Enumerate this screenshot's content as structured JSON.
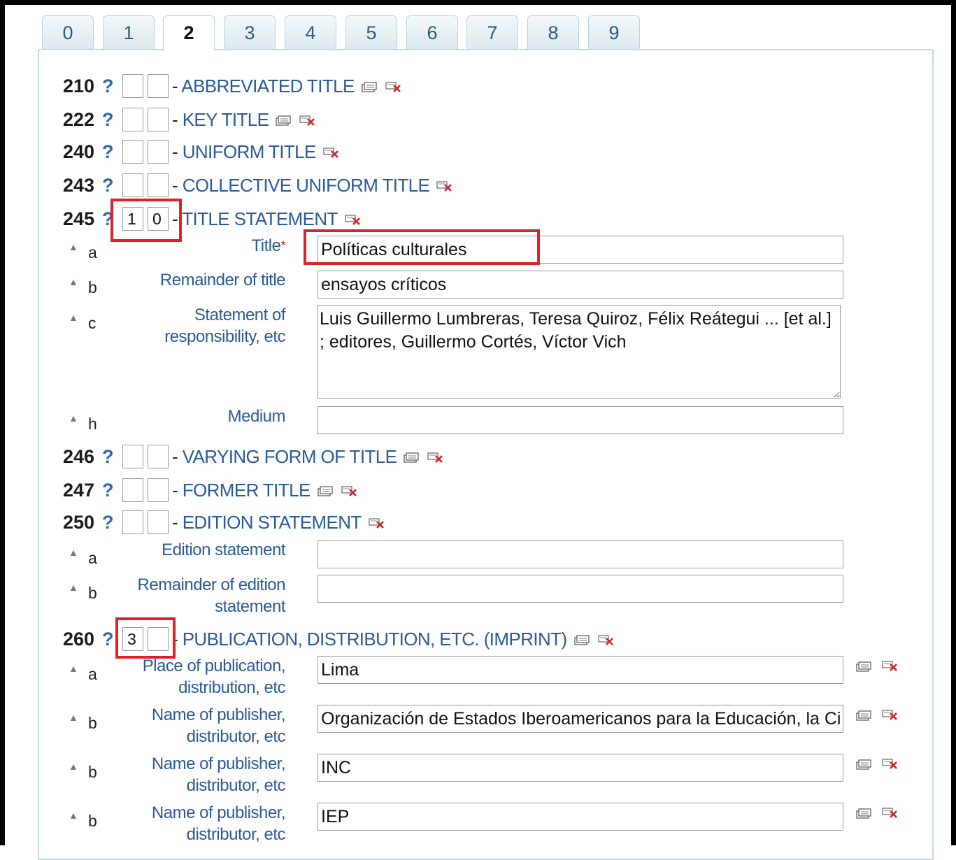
{
  "tabs": [
    "0",
    "1",
    "2",
    "3",
    "4",
    "5",
    "6",
    "7",
    "8",
    "9"
  ],
  "active_tab": "2",
  "help_symbol": "?",
  "fields": {
    "f210": {
      "tag": "210",
      "ind1": "",
      "ind2": "",
      "label": "ABBREVIATED TITLE"
    },
    "f222": {
      "tag": "222",
      "ind1": "",
      "ind2": "",
      "label": "KEY TITLE"
    },
    "f240": {
      "tag": "240",
      "ind1": "",
      "ind2": "",
      "label": "UNIFORM TITLE"
    },
    "f243": {
      "tag": "243",
      "ind1": "",
      "ind2": "",
      "label": "COLLECTIVE UNIFORM TITLE"
    },
    "f245": {
      "tag": "245",
      "ind1": "1",
      "ind2": "0",
      "label": "TITLE STATEMENT",
      "subfields": {
        "a": {
          "code": "a",
          "label": "Title",
          "required_mark": "*",
          "value": "Políticas culturales"
        },
        "b": {
          "code": "b",
          "label": "Remainder of title",
          "value": "ensayos críticos"
        },
        "c": {
          "code": "c",
          "label": "Statement of responsibility, etc",
          "value": "Luis Guillermo Lumbreras, Teresa Quiroz, Félix Reátegui ... [et al.] ; editores, Guillermo Cortés, Víctor Vich"
        },
        "h": {
          "code": "h",
          "label": "Medium",
          "value": ""
        }
      }
    },
    "f246": {
      "tag": "246",
      "ind1": "",
      "ind2": "",
      "label": "VARYING FORM OF TITLE"
    },
    "f247": {
      "tag": "247",
      "ind1": "",
      "ind2": "",
      "label": "FORMER TITLE"
    },
    "f250": {
      "tag": "250",
      "ind1": "",
      "ind2": "",
      "label": "EDITION STATEMENT",
      "subfields": {
        "a": {
          "code": "a",
          "label": "Edition statement",
          "value": ""
        },
        "b": {
          "code": "b",
          "label": "Remainder of edition statement",
          "value": ""
        }
      }
    },
    "f260": {
      "tag": "260",
      "ind1": "3",
      "ind2": "",
      "label": "PUBLICATION, DISTRIBUTION, ETC. (IMPRINT)",
      "subfields": {
        "a": {
          "code": "a",
          "label": "Place of publication, distribution, etc",
          "value": "Lima"
        },
        "b1": {
          "code": "b",
          "label": "Name of publisher, distributor, etc",
          "value": "Organización de Estados Iberoamericanos para la Educación, la Ciencia y la Cultura"
        },
        "b2": {
          "code": "b",
          "label": "Name of publisher, distributor, etc",
          "value": "INC"
        },
        "b3": {
          "code": "b",
          "label": "Name of publisher, distributor, etc",
          "value": "IEP"
        }
      }
    }
  },
  "colors": {
    "link": "#2a5a97",
    "tag": "#1b1b1b",
    "highlight": "#e0202a",
    "panel_border": "#c3dce4"
  },
  "icons": {
    "clone": "clone-field-icon",
    "delete": "delete-field-icon",
    "move_up": "move-up-icon"
  }
}
